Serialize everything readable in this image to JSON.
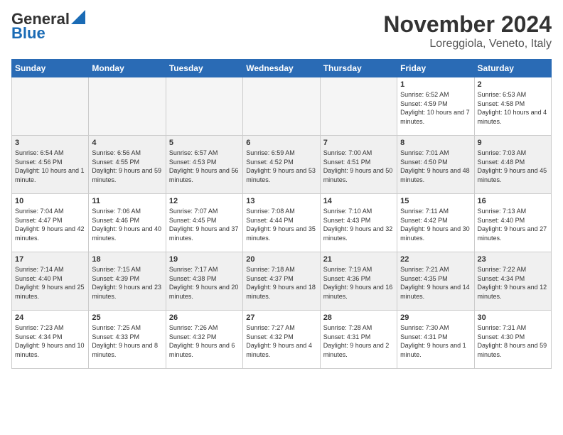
{
  "logo": {
    "line1": "General",
    "line2": "Blue"
  },
  "header": {
    "month": "November 2024",
    "location": "Loreggiola, Veneto, Italy"
  },
  "weekdays": [
    "Sunday",
    "Monday",
    "Tuesday",
    "Wednesday",
    "Thursday",
    "Friday",
    "Saturday"
  ],
  "weeks": [
    [
      {
        "day": "",
        "info": ""
      },
      {
        "day": "",
        "info": ""
      },
      {
        "day": "",
        "info": ""
      },
      {
        "day": "",
        "info": ""
      },
      {
        "day": "",
        "info": ""
      },
      {
        "day": "1",
        "info": "Sunrise: 6:52 AM\nSunset: 4:59 PM\nDaylight: 10 hours and 7 minutes."
      },
      {
        "day": "2",
        "info": "Sunrise: 6:53 AM\nSunset: 4:58 PM\nDaylight: 10 hours and 4 minutes."
      }
    ],
    [
      {
        "day": "3",
        "info": "Sunrise: 6:54 AM\nSunset: 4:56 PM\nDaylight: 10 hours and 1 minute."
      },
      {
        "day": "4",
        "info": "Sunrise: 6:56 AM\nSunset: 4:55 PM\nDaylight: 9 hours and 59 minutes."
      },
      {
        "day": "5",
        "info": "Sunrise: 6:57 AM\nSunset: 4:53 PM\nDaylight: 9 hours and 56 minutes."
      },
      {
        "day": "6",
        "info": "Sunrise: 6:59 AM\nSunset: 4:52 PM\nDaylight: 9 hours and 53 minutes."
      },
      {
        "day": "7",
        "info": "Sunrise: 7:00 AM\nSunset: 4:51 PM\nDaylight: 9 hours and 50 minutes."
      },
      {
        "day": "8",
        "info": "Sunrise: 7:01 AM\nSunset: 4:50 PM\nDaylight: 9 hours and 48 minutes."
      },
      {
        "day": "9",
        "info": "Sunrise: 7:03 AM\nSunset: 4:48 PM\nDaylight: 9 hours and 45 minutes."
      }
    ],
    [
      {
        "day": "10",
        "info": "Sunrise: 7:04 AM\nSunset: 4:47 PM\nDaylight: 9 hours and 42 minutes."
      },
      {
        "day": "11",
        "info": "Sunrise: 7:06 AM\nSunset: 4:46 PM\nDaylight: 9 hours and 40 minutes."
      },
      {
        "day": "12",
        "info": "Sunrise: 7:07 AM\nSunset: 4:45 PM\nDaylight: 9 hours and 37 minutes."
      },
      {
        "day": "13",
        "info": "Sunrise: 7:08 AM\nSunset: 4:44 PM\nDaylight: 9 hours and 35 minutes."
      },
      {
        "day": "14",
        "info": "Sunrise: 7:10 AM\nSunset: 4:43 PM\nDaylight: 9 hours and 32 minutes."
      },
      {
        "day": "15",
        "info": "Sunrise: 7:11 AM\nSunset: 4:42 PM\nDaylight: 9 hours and 30 minutes."
      },
      {
        "day": "16",
        "info": "Sunrise: 7:13 AM\nSunset: 4:40 PM\nDaylight: 9 hours and 27 minutes."
      }
    ],
    [
      {
        "day": "17",
        "info": "Sunrise: 7:14 AM\nSunset: 4:40 PM\nDaylight: 9 hours and 25 minutes."
      },
      {
        "day": "18",
        "info": "Sunrise: 7:15 AM\nSunset: 4:39 PM\nDaylight: 9 hours and 23 minutes."
      },
      {
        "day": "19",
        "info": "Sunrise: 7:17 AM\nSunset: 4:38 PM\nDaylight: 9 hours and 20 minutes."
      },
      {
        "day": "20",
        "info": "Sunrise: 7:18 AM\nSunset: 4:37 PM\nDaylight: 9 hours and 18 minutes."
      },
      {
        "day": "21",
        "info": "Sunrise: 7:19 AM\nSunset: 4:36 PM\nDaylight: 9 hours and 16 minutes."
      },
      {
        "day": "22",
        "info": "Sunrise: 7:21 AM\nSunset: 4:35 PM\nDaylight: 9 hours and 14 minutes."
      },
      {
        "day": "23",
        "info": "Sunrise: 7:22 AM\nSunset: 4:34 PM\nDaylight: 9 hours and 12 minutes."
      }
    ],
    [
      {
        "day": "24",
        "info": "Sunrise: 7:23 AM\nSunset: 4:34 PM\nDaylight: 9 hours and 10 minutes."
      },
      {
        "day": "25",
        "info": "Sunrise: 7:25 AM\nSunset: 4:33 PM\nDaylight: 9 hours and 8 minutes."
      },
      {
        "day": "26",
        "info": "Sunrise: 7:26 AM\nSunset: 4:32 PM\nDaylight: 9 hours and 6 minutes."
      },
      {
        "day": "27",
        "info": "Sunrise: 7:27 AM\nSunset: 4:32 PM\nDaylight: 9 hours and 4 minutes."
      },
      {
        "day": "28",
        "info": "Sunrise: 7:28 AM\nSunset: 4:31 PM\nDaylight: 9 hours and 2 minutes."
      },
      {
        "day": "29",
        "info": "Sunrise: 7:30 AM\nSunset: 4:31 PM\nDaylight: 9 hours and 1 minute."
      },
      {
        "day": "30",
        "info": "Sunrise: 7:31 AM\nSunset: 4:30 PM\nDaylight: 8 hours and 59 minutes."
      }
    ]
  ]
}
